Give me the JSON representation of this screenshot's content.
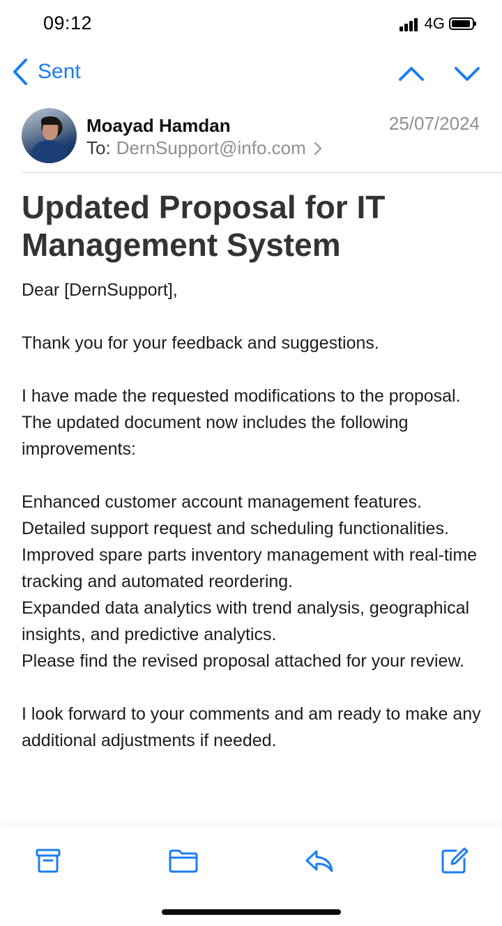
{
  "status_bar": {
    "time": "09:12",
    "network": "4G",
    "signal_icon": "cellular-signal-icon",
    "battery_icon": "battery-icon"
  },
  "nav": {
    "back_label": "Sent",
    "back_icon": "chevron-left-icon",
    "prev_icon": "chevron-up-icon",
    "next_icon": "chevron-down-icon"
  },
  "email": {
    "sender_name": "Moayad Hamdan",
    "date": "25/07/2024",
    "to_label": "To:",
    "to_address": "DernSupport@info.com",
    "subject": "Updated Proposal for IT Management System",
    "body": {
      "greeting": "Dear [DernSupport],",
      "thanks": "Thank you for your feedback and suggestions.",
      "intro": "I have made the requested modifications to the proposal. The updated document now includes the following improvements:",
      "items": [
        "Enhanced customer account management features.",
        "Detailed support request and scheduling functionalities.",
        "Improved spare parts inventory management with real-time tracking and automated reordering.",
        "Expanded data analytics with trend analysis, geographical insights, and predictive analytics.",
        "Please find the revised proposal attached for your review."
      ],
      "closing": "I look forward to your comments and am ready to make any additional adjustments if needed."
    }
  },
  "toolbar": {
    "archive_icon": "archive-icon",
    "folder_icon": "folder-icon",
    "reply_icon": "reply-icon",
    "compose_icon": "compose-icon"
  },
  "colors": {
    "accent": "#1a7cf5",
    "secondary_text": "#8e8e93",
    "subject_text": "#333333"
  }
}
